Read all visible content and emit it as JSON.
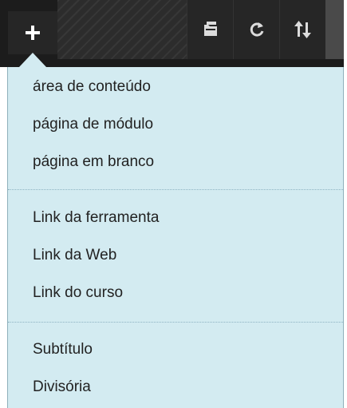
{
  "toolbar": {
    "add_icon": "plus-icon",
    "folder_icon": "folder-icon",
    "refresh_icon": "refresh-icon",
    "sort_icon": "sort-arrows-icon"
  },
  "menu": {
    "groups": [
      {
        "items": [
          "área de conteúdo",
          "página de módulo",
          "página em branco"
        ]
      },
      {
        "items": [
          "Link da ferramenta",
          "Link da Web",
          "Link do curso"
        ]
      },
      {
        "items": [
          "Subtítulo",
          "Divisória"
        ]
      }
    ]
  },
  "colors": {
    "toolbar_bg": "#1c1c1c",
    "menu_bg": "#d3ebf1",
    "text": "#222222",
    "divider": "#8db3c2"
  }
}
